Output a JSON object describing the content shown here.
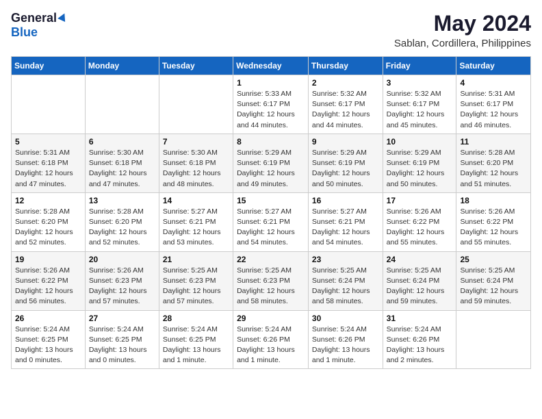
{
  "header": {
    "logo_general": "General",
    "logo_blue": "Blue",
    "month": "May 2024",
    "location": "Sablan, Cordillera, Philippines"
  },
  "weekdays": [
    "Sunday",
    "Monday",
    "Tuesday",
    "Wednesday",
    "Thursday",
    "Friday",
    "Saturday"
  ],
  "weeks": [
    [
      {
        "day": "",
        "info": ""
      },
      {
        "day": "",
        "info": ""
      },
      {
        "day": "",
        "info": ""
      },
      {
        "day": "1",
        "info": "Sunrise: 5:33 AM\nSunset: 6:17 PM\nDaylight: 12 hours\nand 44 minutes."
      },
      {
        "day": "2",
        "info": "Sunrise: 5:32 AM\nSunset: 6:17 PM\nDaylight: 12 hours\nand 44 minutes."
      },
      {
        "day": "3",
        "info": "Sunrise: 5:32 AM\nSunset: 6:17 PM\nDaylight: 12 hours\nand 45 minutes."
      },
      {
        "day": "4",
        "info": "Sunrise: 5:31 AM\nSunset: 6:17 PM\nDaylight: 12 hours\nand 46 minutes."
      }
    ],
    [
      {
        "day": "5",
        "info": "Sunrise: 5:31 AM\nSunset: 6:18 PM\nDaylight: 12 hours\nand 47 minutes."
      },
      {
        "day": "6",
        "info": "Sunrise: 5:30 AM\nSunset: 6:18 PM\nDaylight: 12 hours\nand 47 minutes."
      },
      {
        "day": "7",
        "info": "Sunrise: 5:30 AM\nSunset: 6:18 PM\nDaylight: 12 hours\nand 48 minutes."
      },
      {
        "day": "8",
        "info": "Sunrise: 5:29 AM\nSunset: 6:19 PM\nDaylight: 12 hours\nand 49 minutes."
      },
      {
        "day": "9",
        "info": "Sunrise: 5:29 AM\nSunset: 6:19 PM\nDaylight: 12 hours\nand 50 minutes."
      },
      {
        "day": "10",
        "info": "Sunrise: 5:29 AM\nSunset: 6:19 PM\nDaylight: 12 hours\nand 50 minutes."
      },
      {
        "day": "11",
        "info": "Sunrise: 5:28 AM\nSunset: 6:20 PM\nDaylight: 12 hours\nand 51 minutes."
      }
    ],
    [
      {
        "day": "12",
        "info": "Sunrise: 5:28 AM\nSunset: 6:20 PM\nDaylight: 12 hours\nand 52 minutes."
      },
      {
        "day": "13",
        "info": "Sunrise: 5:28 AM\nSunset: 6:20 PM\nDaylight: 12 hours\nand 52 minutes."
      },
      {
        "day": "14",
        "info": "Sunrise: 5:27 AM\nSunset: 6:21 PM\nDaylight: 12 hours\nand 53 minutes."
      },
      {
        "day": "15",
        "info": "Sunrise: 5:27 AM\nSunset: 6:21 PM\nDaylight: 12 hours\nand 54 minutes."
      },
      {
        "day": "16",
        "info": "Sunrise: 5:27 AM\nSunset: 6:21 PM\nDaylight: 12 hours\nand 54 minutes."
      },
      {
        "day": "17",
        "info": "Sunrise: 5:26 AM\nSunset: 6:22 PM\nDaylight: 12 hours\nand 55 minutes."
      },
      {
        "day": "18",
        "info": "Sunrise: 5:26 AM\nSunset: 6:22 PM\nDaylight: 12 hours\nand 55 minutes."
      }
    ],
    [
      {
        "day": "19",
        "info": "Sunrise: 5:26 AM\nSunset: 6:22 PM\nDaylight: 12 hours\nand 56 minutes."
      },
      {
        "day": "20",
        "info": "Sunrise: 5:26 AM\nSunset: 6:23 PM\nDaylight: 12 hours\nand 57 minutes."
      },
      {
        "day": "21",
        "info": "Sunrise: 5:25 AM\nSunset: 6:23 PM\nDaylight: 12 hours\nand 57 minutes."
      },
      {
        "day": "22",
        "info": "Sunrise: 5:25 AM\nSunset: 6:23 PM\nDaylight: 12 hours\nand 58 minutes."
      },
      {
        "day": "23",
        "info": "Sunrise: 5:25 AM\nSunset: 6:24 PM\nDaylight: 12 hours\nand 58 minutes."
      },
      {
        "day": "24",
        "info": "Sunrise: 5:25 AM\nSunset: 6:24 PM\nDaylight: 12 hours\nand 59 minutes."
      },
      {
        "day": "25",
        "info": "Sunrise: 5:25 AM\nSunset: 6:24 PM\nDaylight: 12 hours\nand 59 minutes."
      }
    ],
    [
      {
        "day": "26",
        "info": "Sunrise: 5:24 AM\nSunset: 6:25 PM\nDaylight: 13 hours\nand 0 minutes."
      },
      {
        "day": "27",
        "info": "Sunrise: 5:24 AM\nSunset: 6:25 PM\nDaylight: 13 hours\nand 0 minutes."
      },
      {
        "day": "28",
        "info": "Sunrise: 5:24 AM\nSunset: 6:25 PM\nDaylight: 13 hours\nand 1 minute."
      },
      {
        "day": "29",
        "info": "Sunrise: 5:24 AM\nSunset: 6:26 PM\nDaylight: 13 hours\nand 1 minute."
      },
      {
        "day": "30",
        "info": "Sunrise: 5:24 AM\nSunset: 6:26 PM\nDaylight: 13 hours\nand 1 minute."
      },
      {
        "day": "31",
        "info": "Sunrise: 5:24 AM\nSunset: 6:26 PM\nDaylight: 13 hours\nand 2 minutes."
      },
      {
        "day": "",
        "info": ""
      }
    ]
  ]
}
